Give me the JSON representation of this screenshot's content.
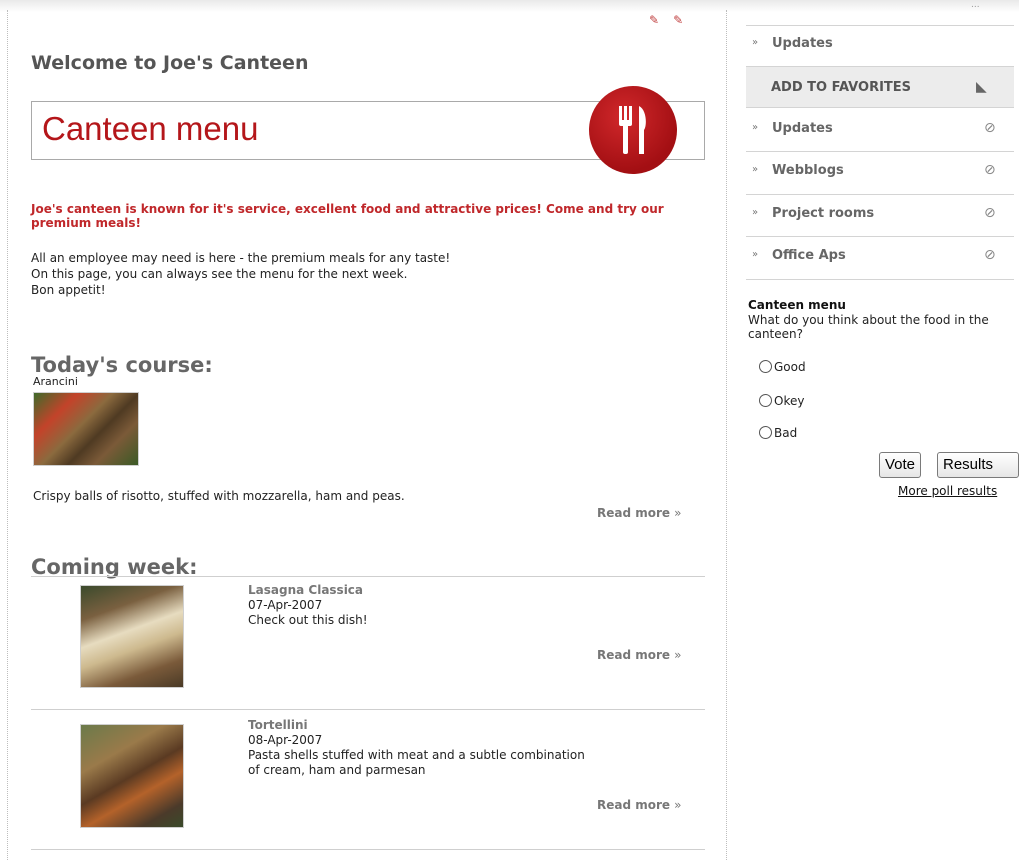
{
  "header": {
    "welcome": "Welcome to Joe's Canteen",
    "banner_title": "Canteen menu"
  },
  "intro": {
    "bold": "Joe's canteen is known for it's service, excellent food and attractive prices! Come and try our premium meals!",
    "line1": "All an employee may need is here - the premium meals for any taste!",
    "line2": "On this page, you can always see the menu for the next week.",
    "line3": "Bon appetit!"
  },
  "today": {
    "heading": "Today's course:",
    "dish": "Arancini",
    "description": "Crispy balls of risotto, stuffed with mozzarella, ham and peas.",
    "read_more": "Read more"
  },
  "coming": {
    "heading": "Coming week:",
    "items": [
      {
        "title": "Lasagna Classica",
        "date": "07-Apr-2007",
        "desc1": "Check out this dish!",
        "desc2": "",
        "read_more": "Read more"
      },
      {
        "title": "Tortellini",
        "date": "08-Apr-2007",
        "desc1": "Pasta shells stuffed with meat and a subtle combination",
        "desc2": "of cream, ham and parmesan",
        "read_more": "Read more"
      }
    ]
  },
  "sidebar": {
    "top_item": "Updates",
    "favorites": "ADD TO FAVORITES",
    "items": [
      {
        "label": "Updates"
      },
      {
        "label": "Webblogs"
      },
      {
        "label": "Project rooms"
      },
      {
        "label": "Office Aps"
      }
    ]
  },
  "poll": {
    "title": "Canteen menu",
    "question": "What do you think about the food in the canteen?",
    "options": [
      "Good",
      "Okey",
      "Bad"
    ],
    "vote_label": "Vote",
    "results_label": "Results",
    "more_link": "More poll results"
  },
  "colors": {
    "accent_red": "#b4161a",
    "intro_red": "#c0282b"
  }
}
